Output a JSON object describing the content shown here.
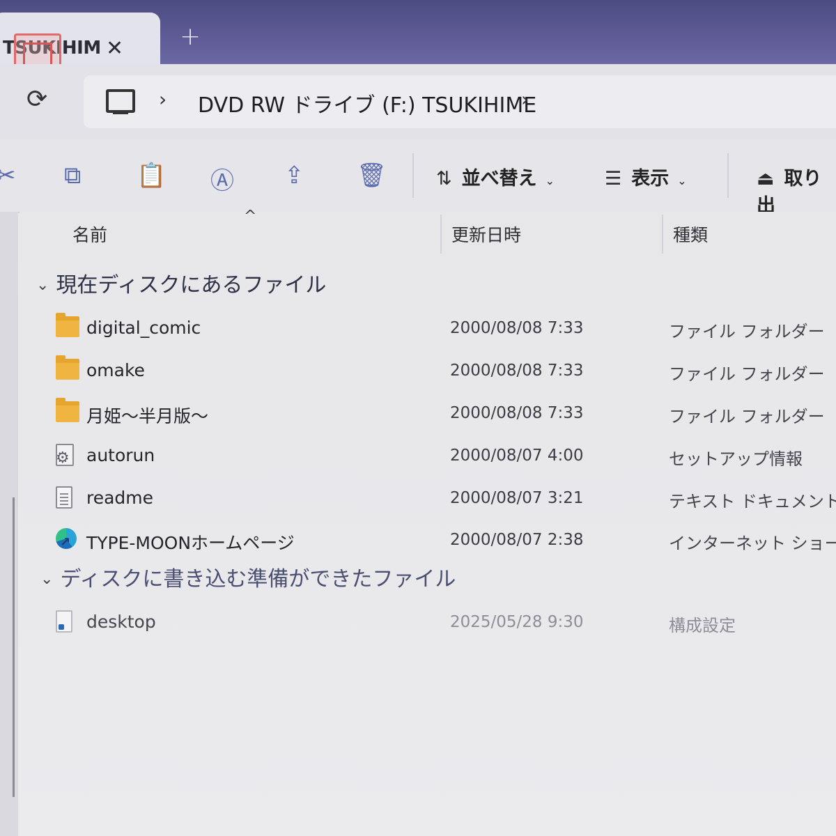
{
  "window": {
    "tab_title": "TSUKIHIM",
    "tab_close": "✕",
    "tab_new": "+"
  },
  "nav": {
    "refresh": "⟳",
    "chevron": "›",
    "breadcrumb": "DVD RW ドライブ (F:) TSUKIHIME",
    "chevron_end": "›"
  },
  "toolbar": {
    "cut_icon": "✂",
    "copy_icon": "⧉",
    "paste_icon": "📋",
    "rename_icon": "Ⓐ",
    "share_icon": "⇪",
    "delete_icon": "🗑",
    "sort_glyph": "⇅",
    "sort_label": "並べ替え",
    "view_glyph": "☰",
    "view_label": "表示",
    "caret": "⌄",
    "eject_glyph": "⏏",
    "eject_label": "取り出"
  },
  "columns": {
    "sort_caret": "^",
    "name": "名前",
    "modified": "更新日時",
    "type": "種類"
  },
  "groups": [
    {
      "chevron": "⌄",
      "label": "現在ディスクにあるファイル",
      "files": [
        {
          "name": "digital_comic",
          "date": "2000/08/08 7:33",
          "type": "ファイル フォルダー",
          "icon": "folder"
        },
        {
          "name": "omake",
          "date": "2000/08/08 7:33",
          "type": "ファイル フォルダー",
          "icon": "folder"
        },
        {
          "name": "月姫〜半月版〜",
          "date": "2000/08/08 7:33",
          "type": "ファイル フォルダー",
          "icon": "folder"
        },
        {
          "name": "autorun",
          "date": "2000/08/07 4:00",
          "type": "セットアップ情報",
          "icon": "setup-file"
        },
        {
          "name": "readme",
          "date": "2000/08/07 3:21",
          "type": "テキスト ドキュメント",
          "icon": "text-document"
        },
        {
          "name": "TYPE-MOONホームページ",
          "date": "2000/08/07 2:38",
          "type": "インターネット ショート...",
          "icon": "internet-shortcut"
        }
      ]
    },
    {
      "chevron": "⌄",
      "label": "ディスクに書き込む準備ができたファイル",
      "files": [
        {
          "name": "desktop",
          "date": "2025/05/28 9:30",
          "type": "構成設定",
          "icon": "config-file"
        }
      ]
    }
  ],
  "colors": {
    "titlebar": "#5d5a96",
    "folder": "#f0b540",
    "toolbar_icon": "#5b6cae"
  }
}
